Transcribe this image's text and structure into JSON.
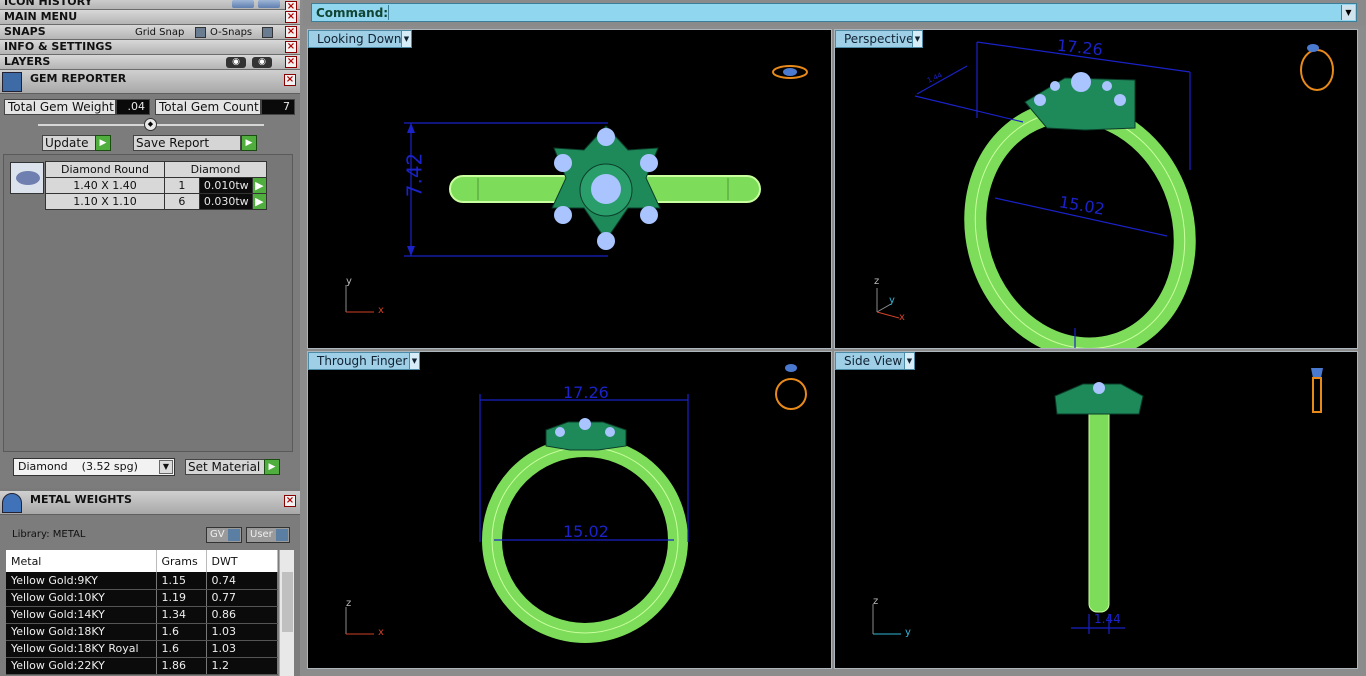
{
  "left_panel": {
    "icon_history": "ICON HISTORY",
    "main_menu": "MAIN MENU",
    "snaps": "SNAPS",
    "grid_snap": "Grid Snap",
    "o_snaps": "O-Snaps",
    "info_settings": "INFO & SETTINGS",
    "layers": "LAYERS",
    "close_glyph": "×"
  },
  "gem_reporter": {
    "title": "GEM REPORTER",
    "total_weight_label": "Total Gem Weight",
    "total_weight_value": ".04",
    "total_count_label": "Total Gem Count",
    "total_count_value": "7",
    "update_label": "Update",
    "save_report_label": "Save Report",
    "table_headers": [
      "Diamond Round",
      "Diamond"
    ],
    "rows": [
      {
        "size": "1.40 X 1.40",
        "count": "1",
        "weight": "0.010tw"
      },
      {
        "size": "1.10 X 1.10",
        "count": "6",
        "weight": "0.030tw"
      }
    ],
    "material_value": "Diamond    (3.52 spg)",
    "set_material_label": "Set Material"
  },
  "metal_weights": {
    "title": "METAL WEIGHTS",
    "library_label": "Library: METAL",
    "gv_label": "GV",
    "user_label": "User",
    "headers": [
      "Metal",
      "Grams",
      "DWT"
    ],
    "rows": [
      {
        "metal": "Yellow Gold:9KY",
        "grams": "1.15",
        "dwt": "0.74"
      },
      {
        "metal": "Yellow Gold:10KY",
        "grams": "1.19",
        "dwt": "0.77"
      },
      {
        "metal": "Yellow Gold:14KY",
        "grams": "1.34",
        "dwt": "0.86"
      },
      {
        "metal": "Yellow Gold:18KY",
        "grams": "1.6",
        "dwt": "1.03"
      },
      {
        "metal": "Yellow Gold:18KY Royal",
        "grams": "1.6",
        "dwt": "1.03"
      },
      {
        "metal": "Yellow Gold:22KY",
        "grams": "1.86",
        "dwt": "1.2"
      }
    ]
  },
  "command": {
    "label": "Command:"
  },
  "viewports": {
    "top_left": {
      "name": "Looking Down",
      "dim_height": "7.42",
      "axis_a": "y",
      "axis_b": "x"
    },
    "top_right": {
      "name": "Perspective",
      "dim_length": "17.26",
      "dim_inner": "15.02",
      "dim_small": "1.44",
      "axis_a": "z",
      "axis_b": "y",
      "axis_c": "x"
    },
    "bottom_left": {
      "name": "Through Finger",
      "dim_width": "17.26",
      "dim_inner": "15.02",
      "axis_a": "z",
      "axis_b": "x"
    },
    "bottom_right": {
      "name": "Side View",
      "dim_band": "1.44",
      "axis_a": "z",
      "axis_b": "y"
    }
  },
  "colors": {
    "ring_green": "#7ddc5a",
    "head_green": "#1e8a5a",
    "gem_blue": "#a9c4ff",
    "dim_blue": "#1a22c8",
    "cmd_cyan": "#8fd6ee"
  }
}
